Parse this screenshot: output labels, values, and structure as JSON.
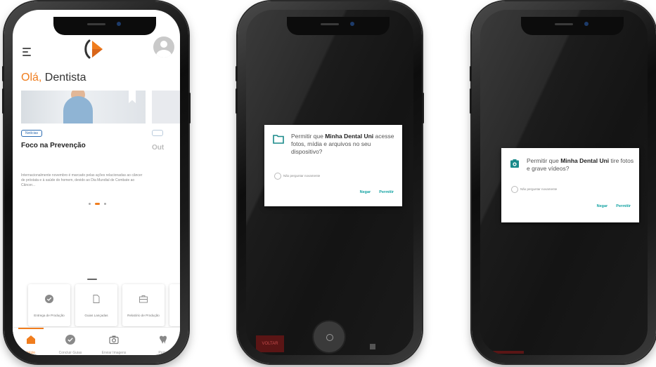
{
  "colors": {
    "accent": "#f07d1e",
    "link": "#15a3a3",
    "tag": "#2c6bb1"
  },
  "phone1": {
    "header": {
      "menu_icon": "hamburger-icon",
      "logo": "brand-logo",
      "avatar_icon": "user-avatar-icon"
    },
    "greeting": {
      "prefix": "Olá,",
      "name": "Dentista"
    },
    "news": {
      "tag": "Notícias",
      "title": "Foco na Prevenção",
      "body": "Internacionalmente novembro é marcado pelas ações relacionadas ao câncer de próstata e à saúde do homem, devido ao Dia Mundial de Combate ao Câncer...",
      "next_title": "Out"
    },
    "tiles": [
      {
        "label": "Entrega de Produção",
        "icon": "check-circle-icon"
      },
      {
        "label": "Guias Lançadas",
        "icon": "document-icon"
      },
      {
        "label": "Relatório de Produção",
        "icon": "briefcase-icon"
      }
    ],
    "nav": [
      {
        "label": "Início",
        "icon": "home-icon"
      },
      {
        "label": "Concluir Guias",
        "icon": "check-circle-icon"
      },
      {
        "label": "Enviar Imagens",
        "icon": "camera-icon"
      },
      {
        "label": "Protet",
        "icon": "tooth-icon"
      }
    ]
  },
  "phone2": {
    "dialog": {
      "msg_pre": "Permitir que ",
      "app": "Minha Dental Uni",
      "msg_post": " acesse fotos, mídia e arquivos no seu dispositivo?",
      "checkbox": "Não perguntar novamente",
      "deny": "Negar",
      "allow": "Permitir",
      "icon": "folder-icon"
    },
    "back": "VOLTAR"
  },
  "phone3": {
    "dialog": {
      "msg_pre": "Permitir que ",
      "app": "Minha Dental Uni",
      "msg_post": " tire fotos e grave vídeos?",
      "checkbox": "Não perguntar novamente",
      "deny": "Negar",
      "allow": "Permitir",
      "icon": "camera-icon"
    }
  }
}
